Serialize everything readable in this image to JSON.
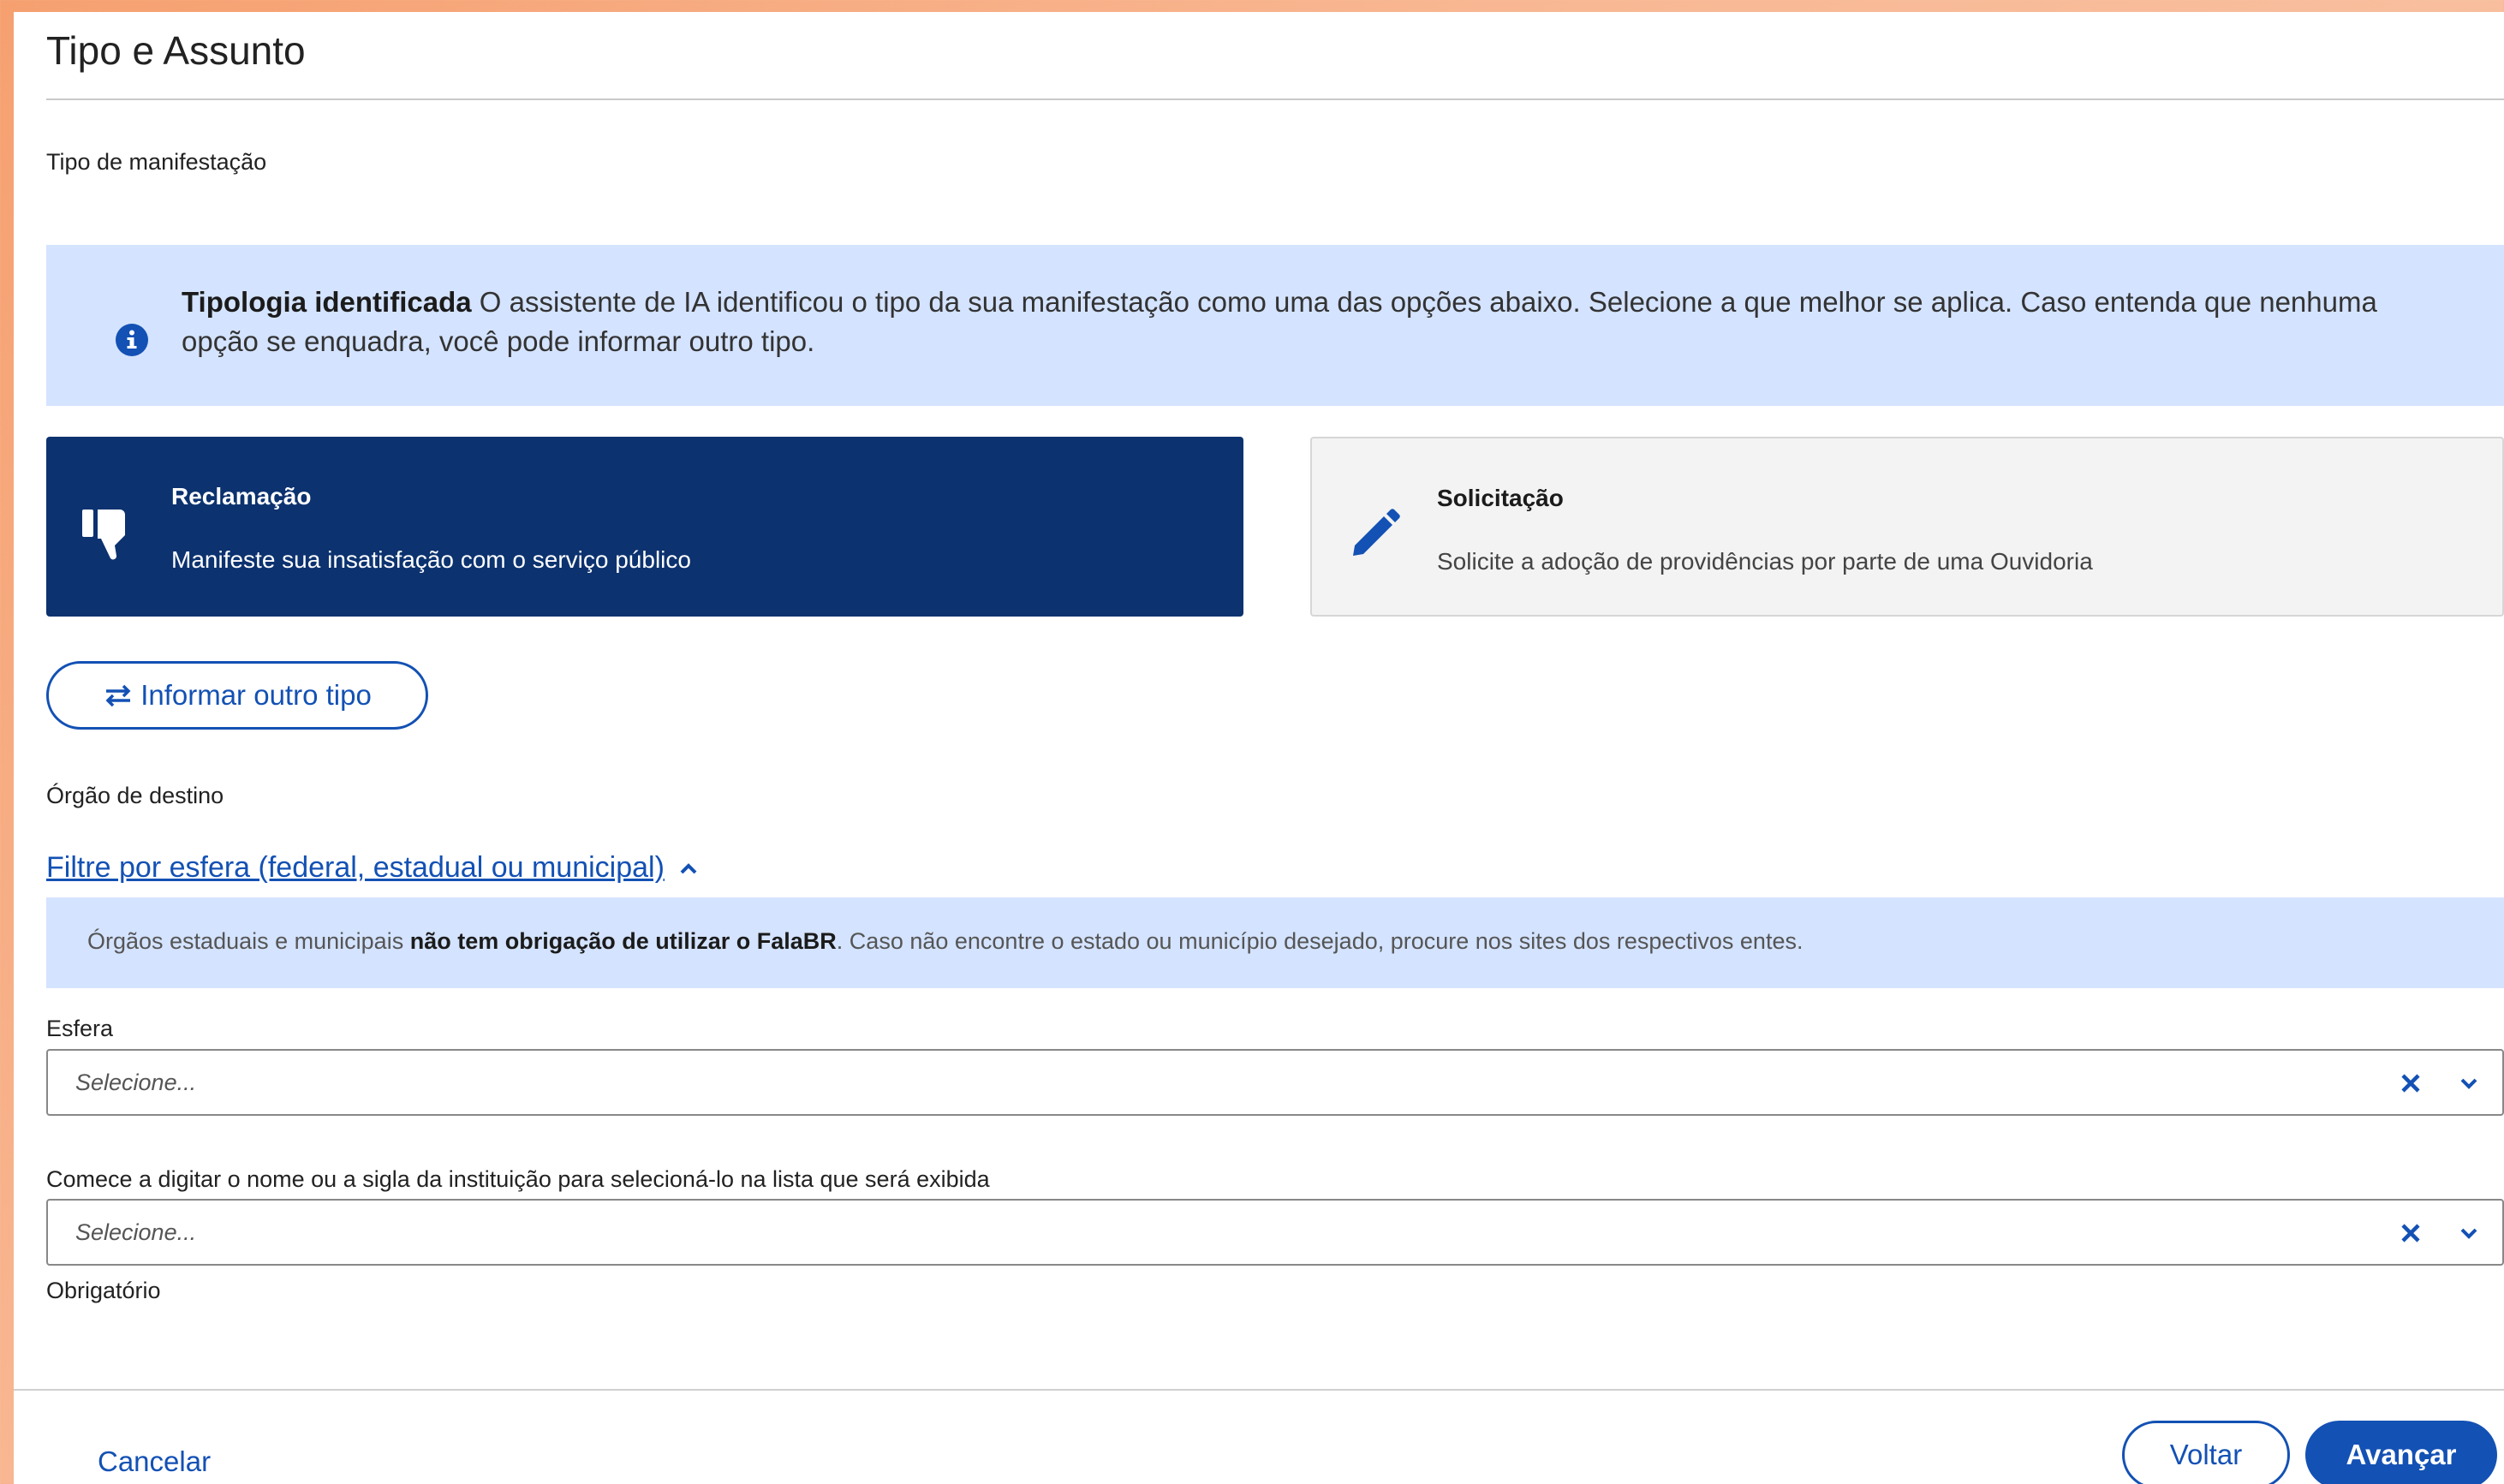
{
  "page": {
    "title": "Tipo e Assunto"
  },
  "tipo_manifestacao": {
    "label": "Tipo de manifestação",
    "ia_alert": {
      "title": "Tipologia identificada",
      "text": " O assistente de IA identificou o tipo da sua manifestação como uma das opções abaixo. Selecione a que melhor se aplica. Caso entenda que nenhuma opção se enquadra, você pode informar outro tipo.",
      "icon": "info-icon"
    },
    "options": [
      {
        "title": "Reclamação",
        "description": "Manifeste sua insatisfação com o serviço público",
        "icon": "thumbs-down-icon",
        "selected": true
      },
      {
        "title": "Solicitação",
        "description": "Solicite a adoção de providências por parte de uma Ouvidoria",
        "icon": "pencil-icon",
        "selected": false
      }
    ],
    "other_type_button": "Informar outro tipo"
  },
  "orgao_destino": {
    "label": "Órgão de destino",
    "filter_link": "Filtre por esfera (federal, estadual ou municipal)",
    "alert": {
      "text_before": "Órgãos estaduais e municipais ",
      "bold": "não tem obrigação de utilizar o FalaBR",
      "text_after": ". Caso não encontre o estado ou município desejado, procure nos sites dos respectivos entes."
    },
    "esfera": {
      "label": "Esfera",
      "placeholder": "Selecione..."
    },
    "instituicao": {
      "label": "Comece a digitar o nome ou a sigla da instituição para selecioná-lo na lista que será exibida",
      "placeholder": "Selecione...",
      "helper": "Obrigatório"
    }
  },
  "footer": {
    "cancel": "Cancelar",
    "back": "Voltar",
    "next": "Avançar"
  },
  "colors": {
    "primary": "#1351b4",
    "selected_card": "#0c326f",
    "alert_bg": "#d4e3ff"
  }
}
